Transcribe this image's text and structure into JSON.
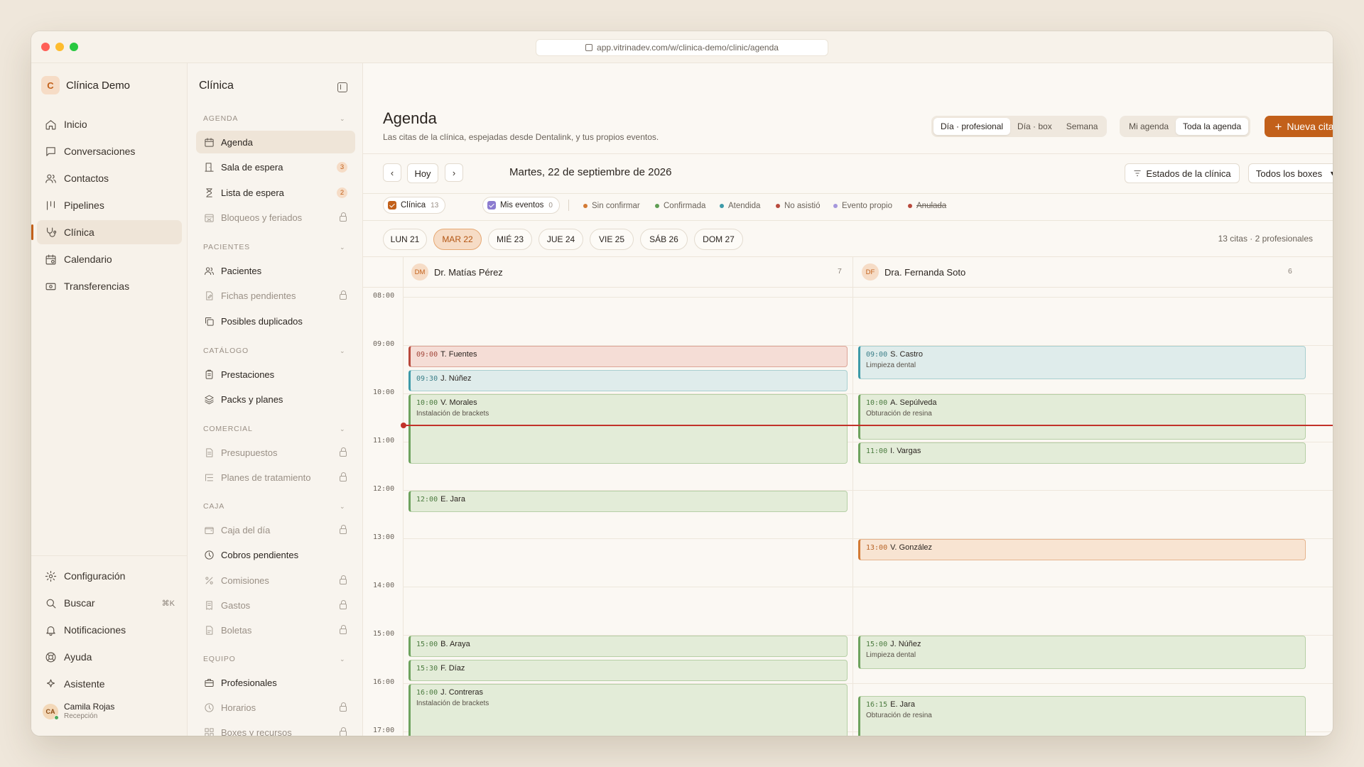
{
  "browser": {
    "url": "app.vitrinadev.com/w/clinica-demo/clinic/agenda"
  },
  "brand": {
    "initial": "C",
    "name": "Clínica Demo"
  },
  "nav": [
    {
      "label": "Inicio",
      "icon": "home-icon"
    },
    {
      "label": "Conversaciones",
      "icon": "chat-icon"
    },
    {
      "label": "Contactos",
      "icon": "contacts-icon"
    },
    {
      "label": "Pipelines",
      "icon": "pipeline-icon"
    },
    {
      "label": "Clínica",
      "icon": "stethoscope-icon",
      "active": true
    },
    {
      "label": "Calendario",
      "icon": "calendar-icon"
    },
    {
      "label": "Transferencias",
      "icon": "transfer-icon"
    }
  ],
  "nav_bottom": [
    {
      "label": "Configuración",
      "icon": "gear-icon"
    },
    {
      "label": "Buscar",
      "icon": "search-icon",
      "shortcut": "⌘K"
    },
    {
      "label": "Notificaciones",
      "icon": "bell-icon"
    },
    {
      "label": "Ayuda",
      "icon": "help-icon"
    },
    {
      "label": "Asistente",
      "icon": "assistant-icon"
    }
  ],
  "user": {
    "initials": "CA",
    "name": "Camila Rojas",
    "role": "Recepción"
  },
  "side2": {
    "title": "Clínica",
    "sections": {
      "agenda": "AGENDA",
      "pacientes": "PACIENTES",
      "catalogo": "CATÁLOGO",
      "comercial": "COMERCIAL",
      "caja": "CAJA",
      "equipo": "EQUIPO"
    },
    "items": {
      "agenda": "Agenda",
      "sala": "Sala de espera",
      "sala_badge": "3",
      "lista": "Lista de espera",
      "lista_badge": "2",
      "bloqueos": "Bloqueos y feriados",
      "pacientes": "Pacientes",
      "fichas": "Fichas pendientes",
      "duplicados": "Posibles duplicados",
      "prestaciones": "Prestaciones",
      "packs": "Packs y planes",
      "presupuestos": "Presupuestos",
      "planes": "Planes de tratamiento",
      "caja_dia": "Caja del día",
      "cobros": "Cobros pendientes",
      "comisiones": "Comisiones",
      "gastos": "Gastos",
      "boletas": "Boletas",
      "profesionales": "Profesionales",
      "horarios": "Horarios",
      "boxes": "Boxes y recursos"
    }
  },
  "header": {
    "title": "Agenda",
    "subtitle": "Las citas de la clínica, espejadas desde Dentalink, y tus propios eventos.",
    "view_modes": [
      "Día · profesional",
      "Día · box",
      "Semana"
    ],
    "scope_modes": [
      "Mi agenda",
      "Toda la agenda"
    ],
    "new_button": "Nueva cita"
  },
  "toolbar": {
    "today": "Hoy",
    "date": "Martes, 22 de septiembre de 2026",
    "estados": "Estados de la clínica",
    "boxes": "Todos los boxes"
  },
  "filters": {
    "clinica": {
      "label": "Clínica",
      "count": "13",
      "color": "#c2601a"
    },
    "mis_eventos": {
      "label": "Mis eventos",
      "count": "0",
      "color": "#8b7bd0"
    }
  },
  "legend": [
    {
      "label": "Sin confirmar",
      "color": "#d37a34"
    },
    {
      "label": "Confirmada",
      "color": "#5f9e54"
    },
    {
      "label": "Atendida",
      "color": "#3d9aa8"
    },
    {
      "label": "No asistió",
      "color": "#b8493c"
    },
    {
      "label": "Evento propio",
      "color": "#a597dc"
    },
    {
      "label": "Anulada",
      "color": "#b8493c"
    }
  ],
  "days": [
    "LUN 21",
    "MAR 22",
    "MIÉ 23",
    "JUE 24",
    "VIE 25",
    "SÁB 26",
    "DOM 27"
  ],
  "summary": "13 citas · 2 profesionales",
  "hours": [
    "08:00",
    "09:00",
    "10:00",
    "11:00",
    "12:00",
    "13:00",
    "14:00",
    "15:00",
    "16:00",
    "17:00"
  ],
  "professionals": [
    {
      "initials": "DM",
      "name": "Dr. Matías Pérez",
      "count": "7",
      "events": [
        {
          "time": "09:00",
          "name": "T. Fuentes",
          "status": "red",
          "start": 9.0,
          "end": 9.5
        },
        {
          "time": "09:30",
          "name": "J. Núñez",
          "status": "blue",
          "start": 9.5,
          "end": 10.0
        },
        {
          "time": "10:00",
          "name": "V. Morales",
          "sub": "Instalación de brackets",
          "status": "green",
          "start": 10.0,
          "end": 11.5
        },
        {
          "time": "12:00",
          "name": "E. Jara",
          "status": "green",
          "start": 12.0,
          "end": 12.5
        },
        {
          "time": "15:00",
          "name": "B. Araya",
          "status": "green",
          "start": 15.0,
          "end": 15.5
        },
        {
          "time": "15:30",
          "name": "F. Díaz",
          "status": "green",
          "start": 15.5,
          "end": 16.0
        },
        {
          "time": "16:00",
          "name": "J. Contreras",
          "sub": "Instalación de brackets",
          "status": "green",
          "start": 16.0,
          "end": 17.5
        }
      ]
    },
    {
      "initials": "DF",
      "name": "Dra. Fernanda Soto",
      "count": "6",
      "events": [
        {
          "time": "09:00",
          "name": "S. Castro",
          "sub": "Limpieza dental",
          "status": "blue",
          "start": 9.0,
          "end": 9.75
        },
        {
          "time": "10:00",
          "name": "A. Sepúlveda",
          "sub": "Obturación de resina",
          "status": "green",
          "start": 10.0,
          "end": 11.0
        },
        {
          "time": "11:00",
          "name": "I. Vargas",
          "status": "green",
          "start": 11.0,
          "end": 11.5
        },
        {
          "time": "13:00",
          "name": "V. González",
          "status": "orange",
          "start": 13.0,
          "end": 13.5
        },
        {
          "time": "15:00",
          "name": "J. Núñez",
          "sub": "Limpieza dental",
          "status": "green",
          "start": 15.0,
          "end": 15.75
        },
        {
          "time": "16:15",
          "name": "E. Jara",
          "sub": "Obturación de resina",
          "status": "green",
          "start": 16.25,
          "end": 17.25
        }
      ]
    }
  ],
  "now_time": 10.65
}
